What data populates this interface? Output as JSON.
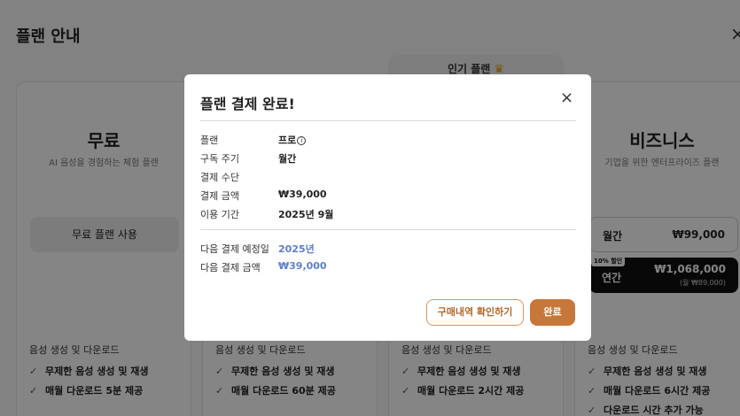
{
  "page": {
    "title": "플랜 안내",
    "close_icon": "×"
  },
  "popular_tab": {
    "label": "인기 플랜",
    "icon": "crown-icon"
  },
  "plans": [
    {
      "name": "무료",
      "description": "AI 음성을 경험하는 체험 플랜",
      "button_label": "무료 플랜 사용",
      "features_heading": "음성 생성 및 다운로드",
      "features": [
        "무제한 음성 생성 및 재생",
        "매월 다운로드 5분 제공"
      ]
    },
    {
      "features_heading": "음성 생성 및 다운로드",
      "features": [
        "무제한 음성 생성 및 재생",
        "매월 다운로드 60분 제공"
      ]
    },
    {
      "features_heading": "음성 생성 및 다운로드",
      "features": [
        "무제한 음성 생성 및 재생",
        "매월 다운로드 2시간 제공"
      ]
    },
    {
      "name": "비즈니스",
      "description": "기업을 위한 엔터프라이즈 플랜",
      "monthly_label": "월간",
      "monthly_price": "₩99,000",
      "discount_badge": "10% 할인",
      "yearly_label": "연간",
      "yearly_price": "₩1,068,000",
      "yearly_sub": "(월 ₩89,000)",
      "features_heading": "음성 생성 및 다운로드",
      "features": [
        "무제한 음성 생성 및 재생",
        "매월 다운로드 6시간 제공",
        "다운로드 시간 추가 가능"
      ]
    }
  ],
  "check_glyph": "✓",
  "modal": {
    "title": "플랜 결제 완료!",
    "close_icon": "×",
    "rows": [
      {
        "key": "플랜",
        "value": "프로"
      },
      {
        "key": "구독 주기",
        "value": "월간"
      },
      {
        "key": "결제 수단",
        "value": ""
      },
      {
        "key": "결제 금액",
        "value": "₩39,000"
      },
      {
        "key": "이용 기간",
        "value": "2025년 9월"
      }
    ],
    "next_rows": [
      {
        "key": "다음 결제 예정일",
        "value": "2025년"
      },
      {
        "key": "다음 결제 금액",
        "value": "₩39,000"
      }
    ],
    "history_button": "구매내역 확인하기",
    "done_button": "완료"
  },
  "colors": {
    "accent": "#c8773a",
    "accent_text": "#b4682a",
    "link_blue": "#5b7fd1",
    "overlay": "rgba(0,0,0,0.48)"
  }
}
